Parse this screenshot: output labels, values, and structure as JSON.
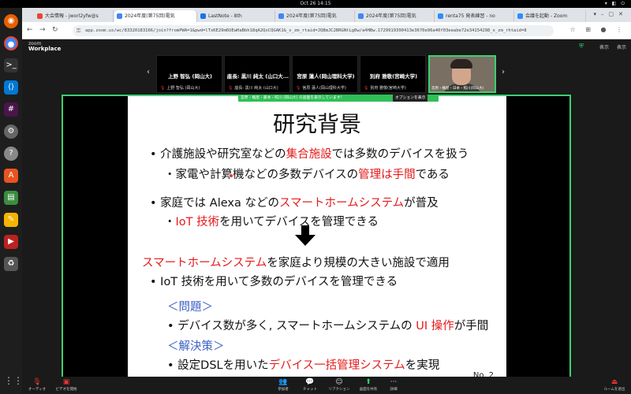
{
  "system": {
    "clock": "Oct 26 14:15"
  },
  "browser": {
    "tabs": [
      {
        "label": "大会情報 - jworl2yfw@s",
        "fav": "#ea4335"
      },
      {
        "label": "2024年度(第75回)電気",
        "fav": "#4285f4"
      },
      {
        "label": "LastNote - 8th",
        "fav": "#1a73e8"
      },
      {
        "label": "2024年度(第75回)電気",
        "fav": "#4285f4"
      },
      {
        "label": "2024年度(第75回)電気",
        "fav": "#4285f4"
      },
      {
        "label": "renta75 発表練習 - no",
        "fav": "#2d8cff"
      },
      {
        "label": "会議を起動 - Zoom",
        "fav": "#2d8cff"
      }
    ],
    "url": "app.zoom.us/wc/83320183166/join?fromPWA=1&pwd=lTxKE29m6UEwHaBbh18qA2QxCQGAK1&_x_zm_rtaid=JQBmJC2BRGNtLg0w/a4HBw.1729919390413e3670e96a40f03eeabe72e34154298_x_zm_rhtaid=8"
  },
  "zoom": {
    "brand": "zoom",
    "product": "Workplace",
    "view_label": "表示",
    "security_label": "",
    "top_right": [
      "表示",
      "表示"
    ],
    "participants": [
      {
        "name": "上野 智弘 (岡山大)",
        "sub": "上野 智弘 (岡山大)"
      },
      {
        "name": "座長: 黒川 純太 (山口大...",
        "sub": "座長: 黒川 純太 (山口大)"
      },
      {
        "name": "宮原 蓮人(岡山理科大学)",
        "sub": "宮原 蓮人(岡山理科大学)"
      },
      {
        "name": "別府 雅敬(宮崎大学)",
        "sub": "別府 雅敬(宮崎大学)"
      }
    ],
    "self_label": "宮原・桶屋・日本・照川(岡山大)",
    "share_banner": "宮原・桶屋・藤本・照川 (岡山大) の画面を表示しています！",
    "share_options": "オプションを表示"
  },
  "slide": {
    "title": "研究背景",
    "lines": [
      {
        "parts": [
          {
            "t": "•  介護施設や研究室などの"
          },
          {
            "t": "集合施設",
            "r": true
          },
          {
            "t": "では多数のデバイスを扱う"
          }
        ]
      },
      {
        "parts": [
          {
            "t": "・家電や計算機などの多数デバイスの"
          },
          {
            "t": "管理は手間",
            "r": true
          },
          {
            "t": "である"
          }
        ]
      },
      {
        "parts": [
          {
            "t": "•  家庭では Alexa などの"
          },
          {
            "t": "スマートホームシステム",
            "r": true
          },
          {
            "t": "が普及"
          }
        ]
      },
      {
        "parts": [
          {
            "t": "・"
          },
          {
            "t": "IoT 技術",
            "r": true
          },
          {
            "t": "を用いてデバイスを管理できる"
          }
        ]
      },
      {
        "parts": [
          {
            "t": "スマートホームシステム",
            "r": true
          },
          {
            "t": "を家庭より規模の大きい施設で適用"
          }
        ]
      },
      {
        "parts": [
          {
            "t": "•  IoT 技術を用いて多数のデバイスを管理できる"
          }
        ]
      },
      {
        "parts": [
          {
            "t": "＜問題＞"
          }
        ],
        "blue": true
      },
      {
        "parts": [
          {
            "t": "•  デバイス数が多く, スマートホームシステムの "
          },
          {
            "t": "UI 操作",
            "r": true
          },
          {
            "t": "が手間"
          }
        ]
      },
      {
        "parts": [
          {
            "t": "＜解決策＞"
          }
        ],
        "blue": true
      },
      {
        "parts": [
          {
            "t": "•  設定DSLを用いた"
          },
          {
            "t": "デバイス一括管理システム",
            "r": true
          },
          {
            "t": "を実現"
          }
        ]
      }
    ],
    "page": "No. 2"
  },
  "toolbar": {
    "audio": "オーディオ",
    "video": "ビデオを開始",
    "participants": "参加者",
    "participants_count": "5",
    "chat": "チャット",
    "reactions": "リアクション",
    "share": "画面を共有",
    "more": "詳細",
    "leave": "ルームを退出"
  }
}
